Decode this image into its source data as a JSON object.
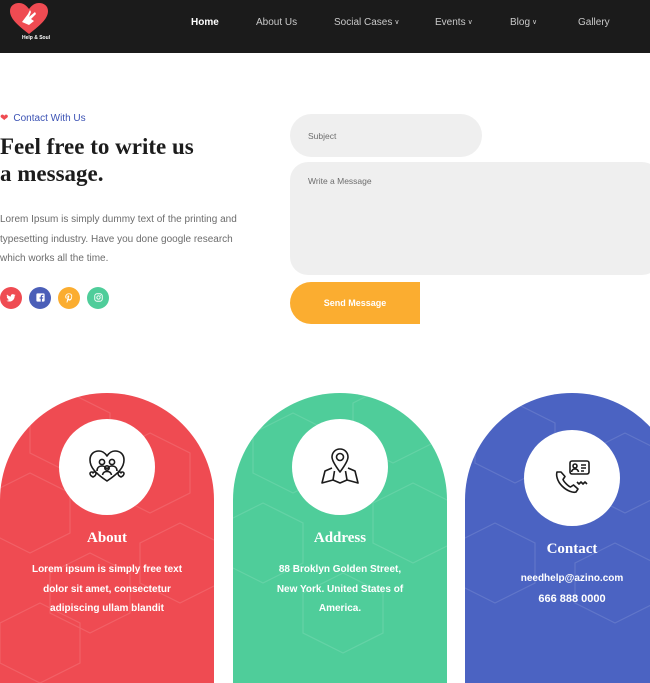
{
  "brand": {
    "logo_text": "Help & Soul",
    "accent": "#ef4b52"
  },
  "nav": {
    "items": [
      {
        "label": "Home",
        "active": true
      },
      {
        "label": "About Us"
      },
      {
        "label": "Social Cases",
        "dropdown": true
      },
      {
        "label": "Events",
        "dropdown": true
      },
      {
        "label": "Blog",
        "dropdown": true
      },
      {
        "label": "Gallery"
      }
    ]
  },
  "contact": {
    "eyebrow": "Contact With Us",
    "headline_line1": "Feel free to write us",
    "headline_line2": "a message.",
    "body_line1": "Lorem Ipsum is simply dummy text of the printing and",
    "body_line2": "typesetting industry. Have you done google research",
    "body_line3": "which works all the time.",
    "social": [
      {
        "icon": "twitter-icon",
        "glyph": "🐦",
        "color": "#ef4b52"
      },
      {
        "icon": "facebook-icon",
        "glyph": "f",
        "color": "#4b5fb8"
      },
      {
        "icon": "pinterest-icon",
        "glyph": "p",
        "color": "#fbad30"
      },
      {
        "icon": "instagram-icon",
        "glyph": "◎",
        "color": "#4fcd9a"
      }
    ]
  },
  "form": {
    "subject_placeholder": "Subject",
    "message_placeholder": "Write a Message",
    "send_label": "Send Message"
  },
  "cards": [
    {
      "title": "About",
      "color": "#ef4b52",
      "icon": "heart-people-icon",
      "lines": [
        "Lorem ipsum is simply free text",
        "dolor sit amet, consectetur",
        "adipiscing ullam blandit"
      ]
    },
    {
      "title": "Address",
      "color": "#4fcd9a",
      "icon": "location-map-icon",
      "lines": [
        "88 Broklyn Golden Street,",
        "New York. United States of",
        "America."
      ]
    },
    {
      "title": "Contact",
      "color": "#4b63c2",
      "icon": "phone-contact-icon",
      "lines": [
        "needhelp@azino.com",
        "666 888 0000"
      ]
    }
  ]
}
